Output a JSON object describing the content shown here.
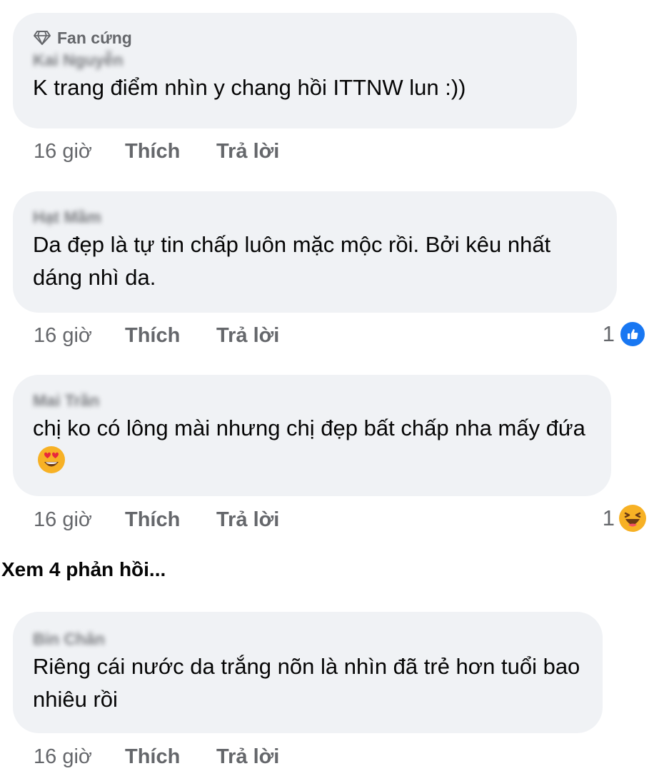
{
  "comments": [
    {
      "badge": "Fan cứng",
      "author": "Kai Nguyễn",
      "text": "K trang điểm nhìn y chang hồi ITTNW lun :))",
      "time": "16 giờ",
      "like_label": "Thích",
      "reply_label": "Trả lời"
    },
    {
      "author": "Hạt Mầm",
      "text": "Da đẹp là tự tin chấp luôn mặc mộc rồi. Bởi kêu nhất dáng nhì da.",
      "time": "16 giờ",
      "like_label": "Thích",
      "reply_label": "Trả lời",
      "reaction_count": "1",
      "reaction_icon": "like-icon"
    },
    {
      "author": "Mai Trần",
      "text": "chị ko có lông mài nhưng chị đẹp bất chấp nha mấy đứa",
      "text_emoji": "heart-eyes-emoji",
      "time": "16 giờ",
      "like_label": "Thích",
      "reply_label": "Trả lời",
      "reaction_count": "1",
      "reaction_icon": "haha-icon"
    },
    {
      "author": "Bin Chân",
      "text": "Riêng cái nước da trắng nõn là nhìn đã trẻ hơn tuổi bao nhiêu rồi",
      "time": "16 giờ",
      "like_label": "Thích",
      "reply_label": "Trả lời"
    }
  ],
  "view_more_replies": "Xem 4 phản hồi...",
  "colors": {
    "bubble": "#f0f2f5",
    "secondary_text": "#65676b",
    "like_blue": "#1877f2",
    "haha_yellow": "#f7b125"
  }
}
